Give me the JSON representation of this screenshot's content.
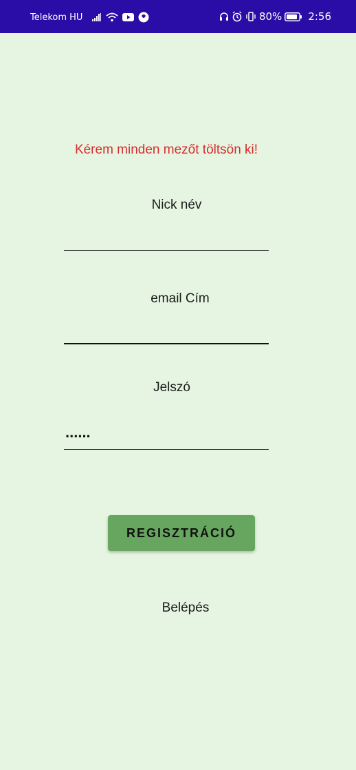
{
  "status_bar": {
    "carrier": "Telekom HU",
    "battery_percent": "80%",
    "time": "2:56",
    "icons_left": [
      "signal-icon",
      "wifi-icon",
      "youtube-icon",
      "app-notification-icon"
    ],
    "icons_right": [
      "headphones-icon",
      "alarm-icon",
      "vibrate-icon",
      "battery-icon"
    ],
    "background_color": "#2A0CA6"
  },
  "form": {
    "error_message": "Kérem minden mezőt töltsön ki!",
    "nick_label": "Nick név",
    "nick_value": "",
    "email_label": "email Cím",
    "email_value": "",
    "password_label": "Jelszó",
    "password_value": "......",
    "register_button": "REGISZTRÁCIÓ",
    "login_link": "Belépés"
  },
  "colors": {
    "background": "#E6F5E2",
    "error": "#D32F2F",
    "button": "#66A65E"
  }
}
